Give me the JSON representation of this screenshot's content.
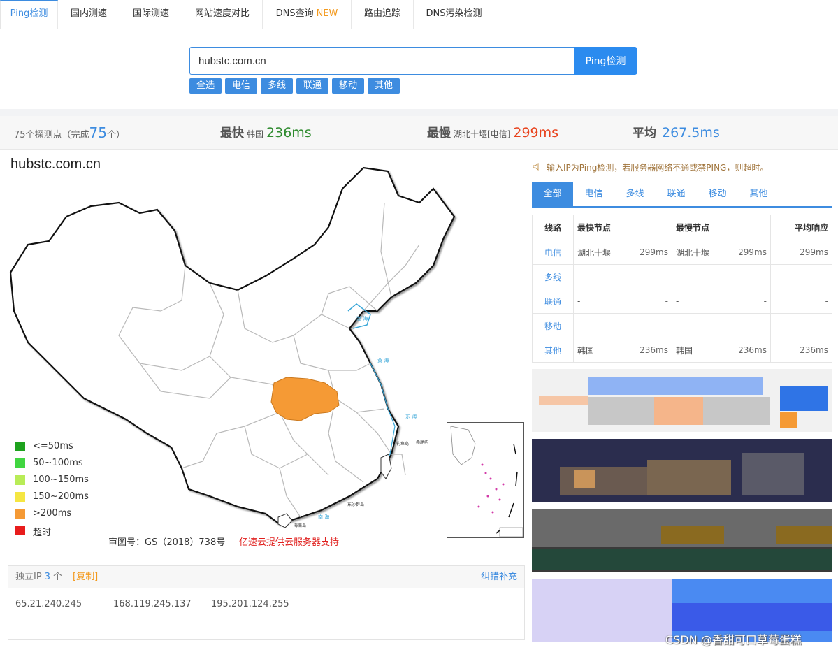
{
  "nav": {
    "tabs": [
      {
        "label": "Ping检测",
        "new": ""
      },
      {
        "label": "国内测速",
        "new": ""
      },
      {
        "label": "国际测速",
        "new": ""
      },
      {
        "label": "网站速度对比",
        "new": ""
      },
      {
        "label": "DNS查询",
        "new": "NEW"
      },
      {
        "label": "路由追踪",
        "new": ""
      },
      {
        "label": "DNS污染检测",
        "new": ""
      }
    ]
  },
  "search": {
    "value": "hubstc.com.cn",
    "button": "Ping检测",
    "filters": [
      "全选",
      "电信",
      "多线",
      "联通",
      "移动",
      "其他"
    ]
  },
  "stats": {
    "count_prefix": "75个探测点（完成",
    "count_done": "75",
    "count_suffix": "个）",
    "fastest_label": "最快",
    "fastest_loc": "韩国",
    "fastest_val": "236ms",
    "slowest_label": "最慢",
    "slowest_loc": "湖北十堰[电信]",
    "slowest_val": "299ms",
    "avg_label": "平均",
    "avg_val": "267.5ms"
  },
  "map": {
    "domain": "hubstc.com.cn",
    "approval": "审图号：GS（2018）738号",
    "sponsor": "亿速云提供云服务器支持",
    "legend": [
      {
        "label": "<=50ms",
        "color": "#1ea21e"
      },
      {
        "label": "50~100ms",
        "color": "#41d641"
      },
      {
        "label": "100~150ms",
        "color": "#b8ec57"
      },
      {
        "label": "150~200ms",
        "color": "#f5e642"
      },
      {
        "label": ">200ms",
        "color": "#f59a35"
      },
      {
        "label": "超时",
        "color": "#e81c1c"
      }
    ],
    "highlight_color": "#f59a35"
  },
  "ip": {
    "title": "独立IP",
    "count": "3",
    "unit": "个",
    "copy": "[复制]",
    "fix": "纠错补充",
    "list": [
      "65.21.240.245",
      "168.119.245.137",
      "195.201.124.255"
    ]
  },
  "right": {
    "notice": "输入IP为Ping检测，若服务器网络不通或禁PING，则超时。",
    "tabs": [
      "全部",
      "电信",
      "多线",
      "联通",
      "移动",
      "其他"
    ],
    "table": {
      "headers": [
        "线路",
        "最快节点",
        "最慢节点",
        "平均响应"
      ],
      "rows": [
        {
          "line": "电信",
          "fast": "湖北十堰",
          "fast_ms": "299ms",
          "slow": "湖北十堰",
          "slow_ms": "299ms",
          "avg": "299ms"
        },
        {
          "line": "多线",
          "fast": "-",
          "fast_ms": "-",
          "slow": "-",
          "slow_ms": "-",
          "avg": "-"
        },
        {
          "line": "联通",
          "fast": "-",
          "fast_ms": "-",
          "slow": "-",
          "slow_ms": "-",
          "avg": "-"
        },
        {
          "line": "移动",
          "fast": "-",
          "fast_ms": "-",
          "slow": "-",
          "slow_ms": "-",
          "avg": "-"
        },
        {
          "line": "其他",
          "fast": "韩国",
          "fast_ms": "236ms",
          "slow": "韩国",
          "slow_ms": "236ms",
          "avg": "236ms"
        }
      ]
    }
  },
  "watermark": "CSDN @香甜可口草莓蛋糕",
  "colors": {
    "accent": "#3d8ce0",
    "fast": "#2e8b2e",
    "slow": "#e8421c",
    "avg": "#3d8ce0"
  }
}
